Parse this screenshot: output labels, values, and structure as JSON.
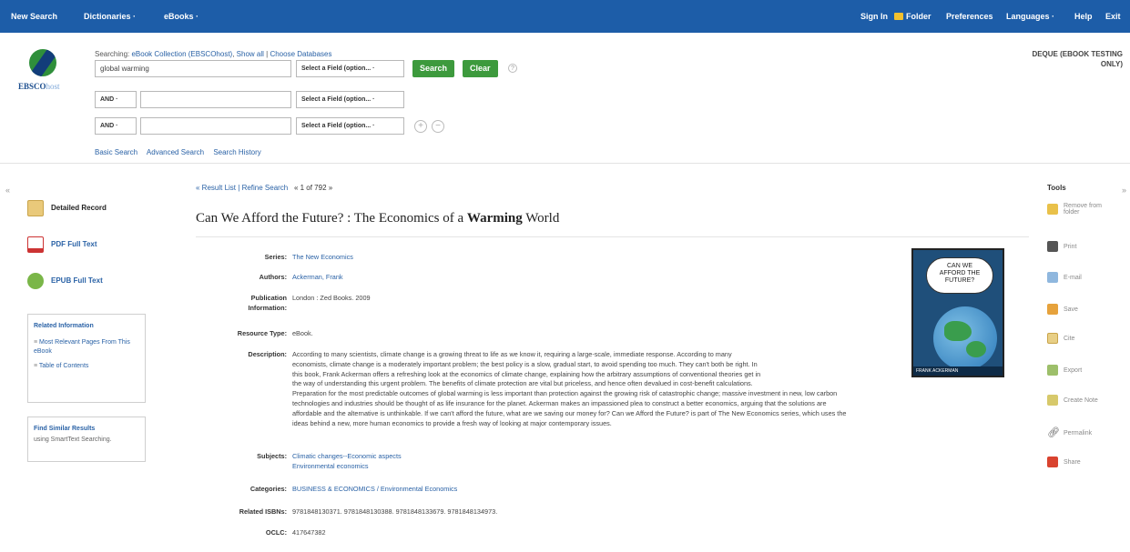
{
  "topbar": {
    "left": [
      "New Search",
      "Dictionaries ·",
      "eBooks ·"
    ],
    "right": [
      "Sign In",
      "Folder",
      "Preferences",
      "Languages ·",
      "Help",
      "Exit"
    ]
  },
  "search": {
    "searching_prefix": "Searching:",
    "collection": "eBook Collection (EBSCOhost)",
    "show_all": "Show all",
    "choose_db": "Choose Databases",
    "query": "global warming",
    "field_select": "Select a Field (option... ·",
    "bool1": "AND ·",
    "bool2": "AND ·",
    "search_label": "Search",
    "clear_label": "Clear",
    "help": "?",
    "links": [
      "Basic Search",
      "Advanced Search",
      "Search History"
    ]
  },
  "logo": {
    "brand": "EBSCO",
    "suffix": "host"
  },
  "account": {
    "line1": "DEQUE (EBOOK TESTING",
    "line2": "ONLY)"
  },
  "left": {
    "formats": [
      "Detailed Record",
      "PDF Full Text",
      "EPUB Full Text"
    ],
    "related_title": "Related Information",
    "related_items": [
      "Most Relevant Pages From This eBook",
      "Table of Contents"
    ],
    "similar_title": "Find Similar Results",
    "similar_sub": "using SmartText Searching."
  },
  "nav": {
    "result_list": "« Result List",
    "refine": "Refine Search",
    "page": "« 1 of 792 »"
  },
  "record": {
    "title_main": "Can We Afford the Future? : The Economics of a ",
    "title_bold": "Warming",
    "title_end": " World",
    "fields": {
      "series": {
        "label": "Series:",
        "value": "The New Economics"
      },
      "authors": {
        "label": "Authors:",
        "value": "Ackerman, Frank"
      },
      "publication_label_1": "Publication",
      "publication_label_2": "Information:",
      "publication_value": "London : Zed Books. 2009",
      "resource": {
        "label": "Resource Type:",
        "value": "eBook."
      },
      "description_label": "Description:",
      "description_lines": [
        "According to many scientists, climate change is a growing threat to life as we know it, requiring a large-scale, immediate response. According to many",
        "economists, climate change is a moderately important problem; the best policy is a slow, gradual start, to avoid spending too much. They can't both be right. In",
        "this book, Frank Ackerman offers a refreshing look at the economics of climate change, explaining how the arbitrary assumptions of conventional theories get in",
        "the way of understanding this urgent problem. The benefits of climate protection are vital but priceless, and hence often devalued in cost-benefit calculations.",
        "Preparation for the most predictable outcomes of global warming is less important than protection against the growing risk of catastrophic change; massive investment in new, low carbon",
        "technologies and industries should be thought of as life insurance for the planet. Ackerman makes an impassioned plea to construct a better economics, arguing that the solutions are",
        "affordable and the alternative is unthinkable. If we can't afford the future, what are we saving our money for? Can we Afford the Future? is part of The New Economics series, which uses the",
        "ideas behind a new, more human economics to provide a fresh way of looking at major contemporary issues."
      ],
      "subjects_label": "Subjects:",
      "subjects": [
        "Climatic changes--Economic aspects",
        "Environmental economics"
      ],
      "categories": {
        "label": "Categories:",
        "value": "BUSINESS & ECONOMICS / Environmental Economics"
      },
      "isbns": {
        "label": "Related ISBNs:",
        "value": "9781848130371. 9781848130388. 9781848133679. 9781848134973."
      },
      "oclc": {
        "label": "OCLC:",
        "value": "417647382"
      }
    }
  },
  "cover": {
    "line1": "CAN WE",
    "line2": "AFFORD THE",
    "line3": "FUTURE?",
    "band": "FRANK ACKERMAN"
  },
  "tools": {
    "title": "Tools",
    "items": [
      "Remove from folder",
      "Print",
      "E-mail",
      "Save",
      "Cite",
      "Export",
      "Create Note",
      "Permalink",
      "Share"
    ]
  },
  "colors": {
    "topbar": "#1d5da8",
    "link": "#2a62a6",
    "button": "#3d9a3d"
  }
}
